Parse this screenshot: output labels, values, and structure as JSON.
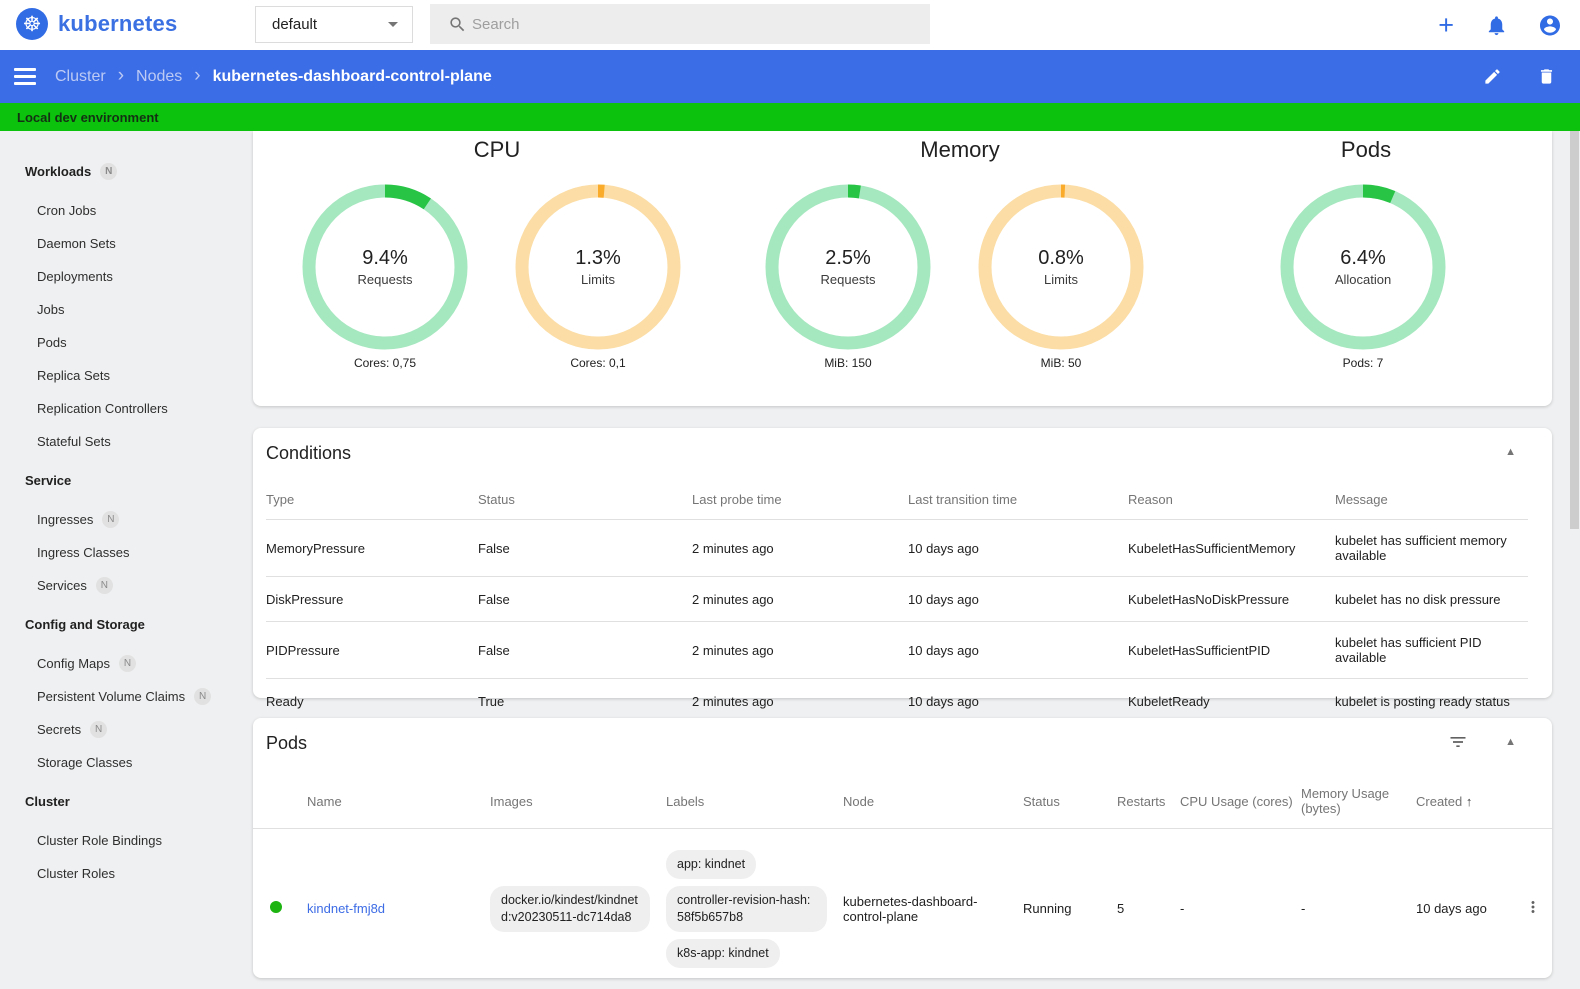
{
  "header": {
    "logo_text": "kubernetes",
    "logo_glyph": "☸",
    "namespace": {
      "value": "default"
    },
    "search": {
      "placeholder": "Search"
    }
  },
  "breadcrumb": {
    "items": [
      "Cluster",
      "Nodes"
    ],
    "separator": "›",
    "current": "kubernetes-dashboard-control-plane"
  },
  "banner": {
    "text": "Local dev environment"
  },
  "sidebar": {
    "sections": [
      {
        "header": "Workloads",
        "badge": "N",
        "items": [
          {
            "label": "Cron Jobs"
          },
          {
            "label": "Daemon Sets"
          },
          {
            "label": "Deployments"
          },
          {
            "label": "Jobs"
          },
          {
            "label": "Pods"
          },
          {
            "label": "Replica Sets"
          },
          {
            "label": "Replication Controllers"
          },
          {
            "label": "Stateful Sets"
          }
        ]
      },
      {
        "header": "Service",
        "items": [
          {
            "label": "Ingresses",
            "badge": "N"
          },
          {
            "label": "Ingress Classes"
          },
          {
            "label": "Services",
            "badge": "N"
          }
        ]
      },
      {
        "header": "Config and Storage",
        "items": [
          {
            "label": "Config Maps",
            "badge": "N"
          },
          {
            "label": "Persistent Volume Claims",
            "badge": "N"
          },
          {
            "label": "Secrets",
            "badge": "N"
          },
          {
            "label": "Storage Classes"
          }
        ]
      },
      {
        "header": "Cluster",
        "items": [
          {
            "label": "Cluster Role Bindings"
          },
          {
            "label": "Cluster Roles"
          }
        ]
      }
    ]
  },
  "allocation": {
    "titles": {
      "cpu": "CPU",
      "memory": "Memory",
      "pods": "Pods"
    },
    "donuts": [
      {
        "id": "cpu-requests",
        "percent": 9.4,
        "percent_text": "9.4%",
        "label": "Requests",
        "caption": "Cores: 0,75",
        "palette": "green"
      },
      {
        "id": "cpu-limits",
        "percent": 1.3,
        "percent_text": "1.3%",
        "label": "Limits",
        "caption": "Cores: 0,1",
        "palette": "orange"
      },
      {
        "id": "memory-requests",
        "percent": 2.5,
        "percent_text": "2.5%",
        "label": "Requests",
        "caption": "MiB: 150",
        "palette": "green"
      },
      {
        "id": "memory-limits",
        "percent": 0.8,
        "percent_text": "0.8%",
        "label": "Limits",
        "caption": "MiB: 50",
        "palette": "orange"
      },
      {
        "id": "pods-allocation",
        "percent": 6.4,
        "percent_text": "6.4%",
        "label": "Allocation",
        "caption": "Pods: 7",
        "palette": "green"
      }
    ]
  },
  "colors": {
    "accent_blue": "#326ce5",
    "bar_blue": "#3b6de6",
    "banner_green": "#0cc20c",
    "green_arc": "#28c445",
    "green_ring": "#a5e7bf",
    "orange_arc": "#fbab2a",
    "orange_ring": "#fbdda5",
    "link_blue": "#3d6ce5",
    "status_green": "#1db310"
  },
  "conditions": {
    "title": "Conditions",
    "columns": [
      "Type",
      "Status",
      "Last probe time",
      "Last transition time",
      "Reason",
      "Message"
    ],
    "rows": [
      {
        "type": "MemoryPressure",
        "status": "False",
        "probe": "2 minutes ago",
        "transition": "10 days ago",
        "reason": "KubeletHasSufficientMemory",
        "message": "kubelet has sufficient memory available"
      },
      {
        "type": "DiskPressure",
        "status": "False",
        "probe": "2 minutes ago",
        "transition": "10 days ago",
        "reason": "KubeletHasNoDiskPressure",
        "message": "kubelet has no disk pressure"
      },
      {
        "type": "PIDPressure",
        "status": "False",
        "probe": "2 minutes ago",
        "transition": "10 days ago",
        "reason": "KubeletHasSufficientPID",
        "message": "kubelet has sufficient PID available"
      },
      {
        "type": "Ready",
        "status": "True",
        "probe": "2 minutes ago",
        "transition": "10 days ago",
        "reason": "KubeletReady",
        "message": "kubelet is posting ready status"
      }
    ]
  },
  "pods": {
    "title": "Pods",
    "columns": [
      "Name",
      "Images",
      "Labels",
      "Node",
      "Status",
      "Restarts",
      "CPU Usage (cores)",
      "Memory Usage (bytes)",
      "Created"
    ],
    "sort_arrow": "↑",
    "rows": [
      {
        "name": "kindnet-fmj8d",
        "image": "docker.io/kindest/kindnetd:v20230511-dc714da8",
        "labels": [
          "app: kindnet",
          "controller-revision-hash: 58f5b657b8",
          "k8s-app: kindnet"
        ],
        "node": "kubernetes-dashboard-control-plane",
        "status": "Running",
        "restarts": "5",
        "cpu": "-",
        "memory": "-",
        "created": "10 days ago"
      }
    ]
  }
}
